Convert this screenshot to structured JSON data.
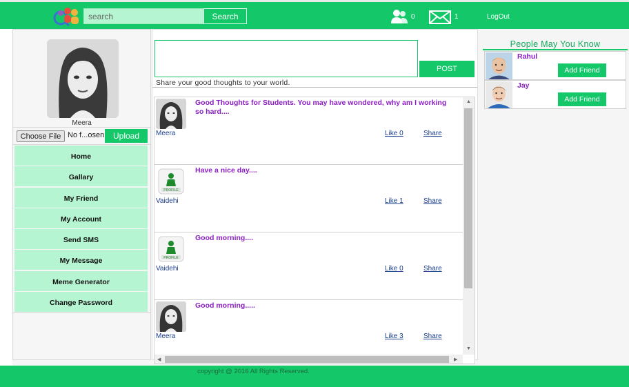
{
  "header": {
    "search_placeholder": "search",
    "search_button": "Search",
    "friends_count": "0",
    "messages_count": "1",
    "logout": "LogOut"
  },
  "profile": {
    "name": "Meera",
    "choose_file": "Choose File",
    "file_status": "No f...osen",
    "upload": "Upload"
  },
  "nav": [
    "Home",
    "Gallary",
    "My Friend",
    "My Account",
    "Send SMS",
    "My Message",
    "Meme Generator",
    "Change Password"
  ],
  "composer": {
    "post_button": "POST",
    "hint": "Share your good thoughts to your world."
  },
  "feed": [
    {
      "author": "Meera",
      "avatar": "photo",
      "text": "Good Thoughts for Students. You may have wondered, why am I working so hard....",
      "like_label": "Like",
      "likes": "0",
      "share": "Share"
    },
    {
      "author": "Vaidehi",
      "avatar": "profile-placeholder",
      "text": "Have a nice day....",
      "like_label": "Like",
      "likes": "1",
      "share": "Share"
    },
    {
      "author": "Vaidehi",
      "avatar": "profile-placeholder",
      "text": "Good morning....",
      "like_label": "Like",
      "likes": "0",
      "share": "Share"
    },
    {
      "author": "Meera",
      "avatar": "photo",
      "text": "Good morning.....",
      "like_label": "Like",
      "likes": "3",
      "share": "Share"
    }
  ],
  "people_may_know": {
    "title": "People May You Know",
    "people": [
      {
        "name": "Rahul",
        "button": "Add Friend"
      },
      {
        "name": "Jay",
        "button": "Add Friend"
      }
    ]
  },
  "footer": {
    "copyright": "copyright @ 2016 All Rights Reserved."
  },
  "colors": {
    "brand_green": "#14c86a",
    "light_green": "#b6f5d2",
    "post_text_purple": "#8b1fc2",
    "link_blue": "#1a3d8c"
  }
}
